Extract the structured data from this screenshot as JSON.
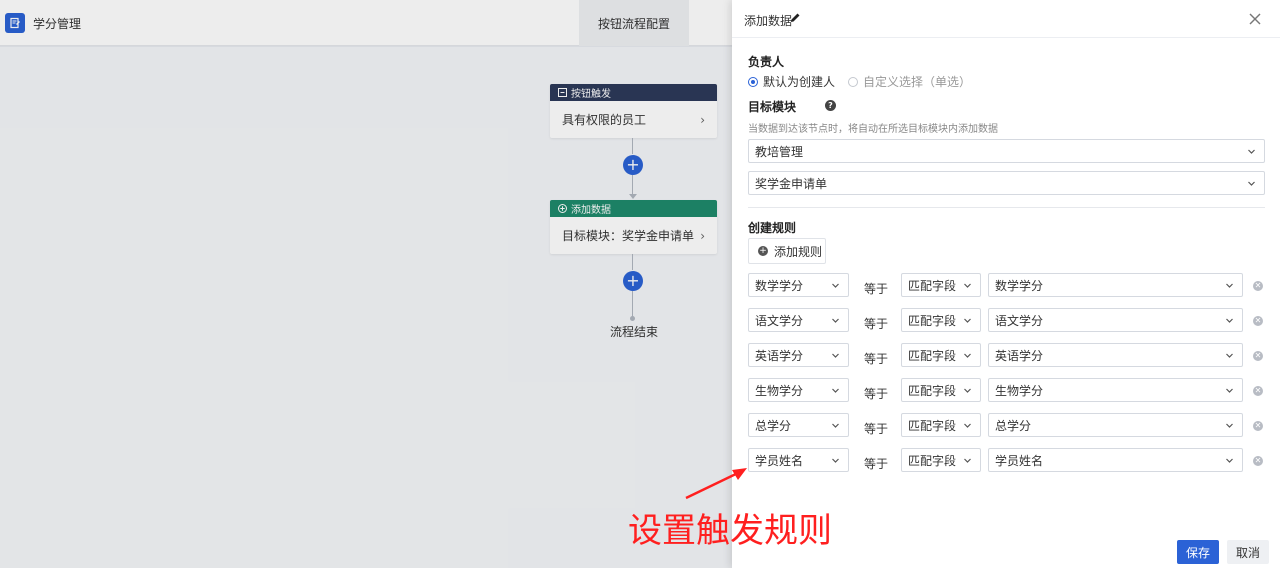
{
  "app": {
    "title": "学分管理",
    "tab": "按钮流程配置"
  },
  "flow": {
    "trigger_card": {
      "header": "按钮触发",
      "body": "具有权限的员工"
    },
    "add_card": {
      "header": "添加数据",
      "body": "目标模块：奖学金申请单"
    },
    "end_label": "流程结束"
  },
  "drawer": {
    "title": "添加数据",
    "owner": {
      "label": "负责人",
      "option_default": "默认为创建人",
      "option_custom": "自定义选择（单选）",
      "selected": "默认为创建人"
    },
    "target": {
      "label": "目标模块",
      "hint": "当数据到达该节点时，将自动在所选目标模块内添加数据",
      "module": "教培管理",
      "form": "奖学金申请单"
    },
    "rules": {
      "label": "创建规则",
      "add_button": "添加规则",
      "equals": "等于",
      "items": [
        {
          "field": "数学学分",
          "mode": "匹配字段",
          "value": "数学学分"
        },
        {
          "field": "语文学分",
          "mode": "匹配字段",
          "value": "语文学分"
        },
        {
          "field": "英语学分",
          "mode": "匹配字段",
          "value": "英语学分"
        },
        {
          "field": "生物学分",
          "mode": "匹配字段",
          "value": "生物学分"
        },
        {
          "field": "总学分",
          "mode": "匹配字段",
          "value": "总学分"
        },
        {
          "field": "学员姓名",
          "mode": "匹配字段",
          "value": "学员姓名"
        }
      ]
    },
    "save_label": "保存",
    "cancel_label": "取消"
  },
  "annotation": {
    "text": "设置触发规则",
    "color": "#ff1f1f"
  },
  "colors": {
    "primary": "#2b62d6",
    "trigger_header": "#2d3a5a",
    "add_header": "#1f8a6c"
  }
}
